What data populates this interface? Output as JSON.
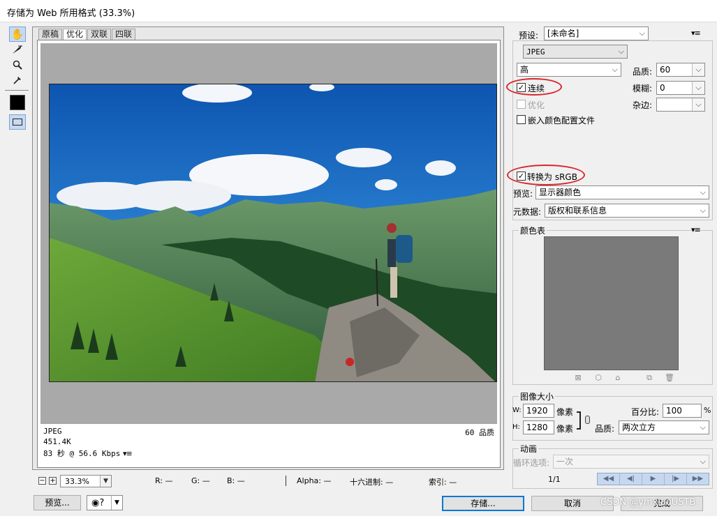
{
  "window": {
    "title": "存储为 Web 所用格式 (33.3%)"
  },
  "toolbar": {
    "tools": [
      "hand-icon",
      "slice-select-icon",
      "zoom-icon",
      "eyedropper-icon"
    ]
  },
  "tabs": [
    "原稿",
    "优化",
    "双联",
    "四联"
  ],
  "active_tab": "优化",
  "preview_info": {
    "format": "JPEG",
    "size": "451.4K",
    "time": "83 秒 @ 56.6 Kbps",
    "quality": "60 品质"
  },
  "statusbar": {
    "zoom": "33.3%",
    "r": "R: —",
    "g": "G: —",
    "b": "B: —",
    "alpha": "Alpha: —",
    "hex": "十六进制: —",
    "index": "索引: —"
  },
  "buttons": {
    "preview": "预览...",
    "save": "存储...",
    "cancel": "取消",
    "done": "完成"
  },
  "settings": {
    "preset_label": "预设:",
    "preset_value": "[未命名]",
    "format_value": "JPEG",
    "compression_value": "高",
    "quality_label": "品质:",
    "quality_value": "60",
    "progressive_label": "连续",
    "progressive_checked": true,
    "blur_label": "模糊:",
    "blur_value": "0",
    "optimized_label": "优化",
    "matte_label": "杂边:",
    "matte_value": "",
    "embed_profile_label": "嵌入颜色配置文件",
    "convert_srgb_label": "转换为 sRGB",
    "convert_srgb_checked": true,
    "preview_label": "预览:",
    "preview_value": "显示器颜色",
    "metadata_label": "元数据:",
    "metadata_value": "版权和联系信息"
  },
  "color_table": {
    "title": "颜色表"
  },
  "image_size": {
    "title": "图像大小",
    "w_label": "W:",
    "w_value": "1920",
    "h_label": "H:",
    "h_value": "1280",
    "px_unit": "像素",
    "percent_label": "百分比:",
    "percent_value": "100",
    "percent_unit": "%",
    "quality_label": "品质:",
    "quality_value": "两次立方"
  },
  "animation": {
    "title": "动画",
    "loop_label": "循环选项:",
    "loop_value": "一次",
    "frame": "1/1"
  },
  "watermark": "CSDN @ymxiaoUSTB",
  "colors": {
    "accent": "#0078d7",
    "annotation": "#d9262c",
    "sky": "#1f6fc4",
    "grass": "#4e8a2c"
  }
}
